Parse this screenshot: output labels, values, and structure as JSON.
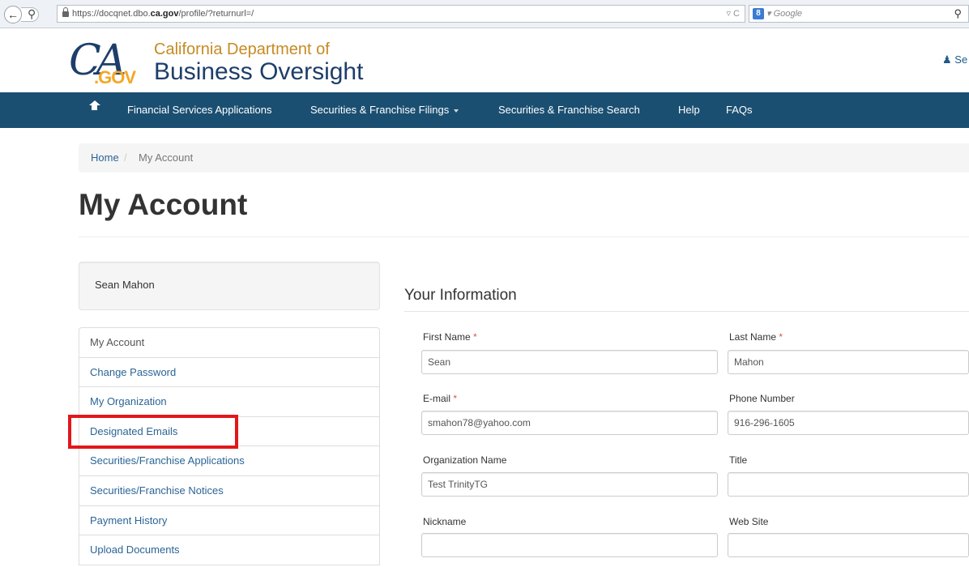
{
  "browser": {
    "url_prefix": "https://docqnet.dbo.",
    "url_domain": "ca.gov",
    "url_suffix": "/profile/?returnurl=/",
    "addr_tools": "▿ C",
    "search_engine_glyph": "8",
    "search_placeholder": "▾ Google"
  },
  "logo": {
    "ca": "CA",
    "gov": ".GOV"
  },
  "header": {
    "dept_line1": "California Department of",
    "dept_line2": "Business Oversight",
    "user_link": "Se"
  },
  "nav": {
    "items": [
      {
        "label": "Financial Services Applications"
      },
      {
        "label": "Securities & Franchise Filings"
      },
      {
        "label": "Securities & Franchise Search"
      },
      {
        "label": "Help"
      },
      {
        "label": "FAQs"
      }
    ]
  },
  "breadcrumb": {
    "home": "Home",
    "separator": "/",
    "current": "My Account"
  },
  "page": {
    "title": "My Account"
  },
  "sidebar": {
    "user_name": "Sean Mahon",
    "items": [
      {
        "label": "My Account"
      },
      {
        "label": "Change Password"
      },
      {
        "label": "My Organization"
      },
      {
        "label": "Designated Emails"
      },
      {
        "label": "Securities/Franchise Applications"
      },
      {
        "label": "Securities/Franchise Notices"
      },
      {
        "label": "Payment History"
      },
      {
        "label": "Upload Documents"
      }
    ]
  },
  "form": {
    "section_title": "Your Information",
    "required_marker": "*",
    "fields": {
      "first_name": {
        "label": "First Name",
        "value": "Sean"
      },
      "last_name": {
        "label": "Last Name",
        "value": "Mahon"
      },
      "email": {
        "label": "E-mail",
        "value": "smahon78@yahoo.com"
      },
      "phone": {
        "label": "Phone Number",
        "value": "916-296-1605"
      },
      "org_name": {
        "label": "Organization Name",
        "value": "Test TrinityTG"
      },
      "title": {
        "label": "Title",
        "value": ""
      },
      "nickname": {
        "label": "Nickname",
        "value": ""
      },
      "website": {
        "label": "Web Site",
        "value": ""
      }
    }
  },
  "colors": {
    "navbar": "#1b4f72",
    "link": "#2a6496",
    "highlight": "#e3161c",
    "required": "#d9534f"
  }
}
